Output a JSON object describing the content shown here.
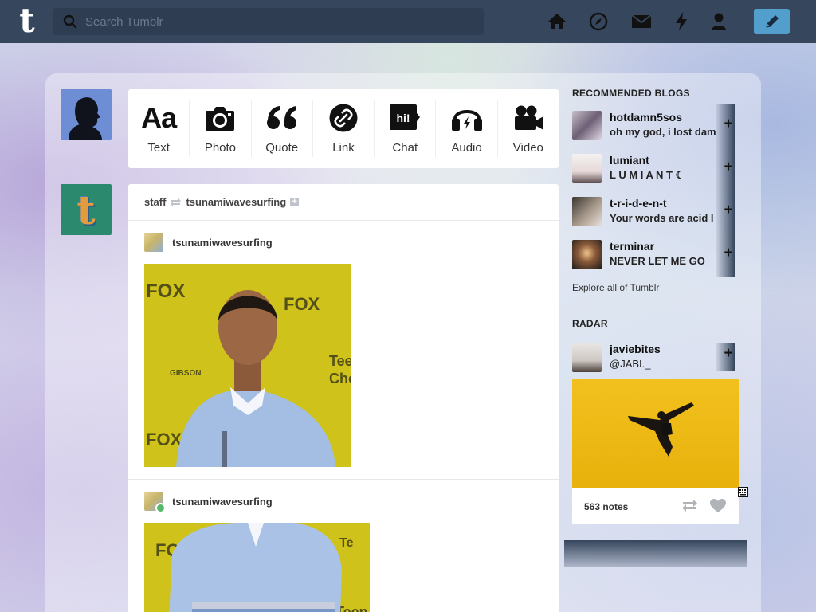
{
  "header": {
    "logo": "t",
    "search_placeholder": "Search Tumblr",
    "nav_icons": [
      "home-icon",
      "explore-icon",
      "inbox-icon",
      "activity-icon",
      "account-icon"
    ],
    "compose_icon": "pencil-icon"
  },
  "colors": {
    "topbar": "#36465d",
    "accent": "#529ecc"
  },
  "post_types": [
    {
      "label": "Text",
      "icon": "text-icon"
    },
    {
      "label": "Photo",
      "icon": "camera-icon"
    },
    {
      "label": "Quote",
      "icon": "quote-icon"
    },
    {
      "label": "Link",
      "icon": "link-icon"
    },
    {
      "label": "Chat",
      "icon": "chat-icon"
    },
    {
      "label": "Audio",
      "icon": "headphones-icon"
    },
    {
      "label": "Video",
      "icon": "video-camera-icon"
    }
  ],
  "post_type_glyphs": {
    "text": "Aa",
    "quote": "66",
    "chat": "hi!"
  },
  "feed": {
    "reblog_from": "staff",
    "reblog_to": "tsunamiwavesurfing",
    "posts": [
      {
        "author": "tsunamiwavesurfing"
      },
      {
        "author": "tsunamiwavesurfing"
      }
    ]
  },
  "sidebar": {
    "recommended_title": "RECOMMENDED BLOGS",
    "recommended": [
      {
        "name": "hotdamn5sos",
        "subtitle": "oh my god, i lost dam"
      },
      {
        "name": "lumiant",
        "subtitle": "L U M I A N T ☾"
      },
      {
        "name": "t-r-i-d-e-n-t",
        "subtitle": "Your words are acid l"
      },
      {
        "name": "terminar",
        "subtitle": "NEVER LET ME GO"
      }
    ],
    "follow_symbol": "+",
    "explore_link": "Explore all of Tumblr",
    "radar_title": "RADAR",
    "radar": {
      "name": "javiebites",
      "subtitle": "@JABI._",
      "notes": "563 notes"
    }
  }
}
